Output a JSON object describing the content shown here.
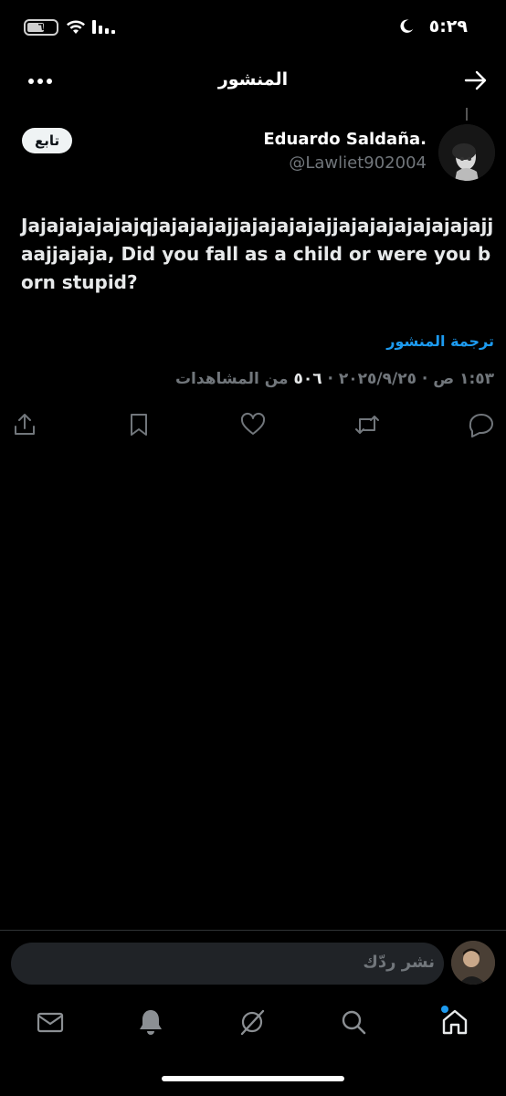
{
  "status_bar": {
    "time": "٥:٢٩",
    "battery_level": "٦"
  },
  "header": {
    "title": "المنشور"
  },
  "author": {
    "name": "Eduardo Saldaña.",
    "handle": "@Lawliet902004",
    "follow_label": "تابع"
  },
  "post": {
    "text": "Jajajajajajajqjajajajajjajajajajajjajajajajajajajajjaajjajaja, Did you fall as a child or were you born stupid?",
    "translate_label": "ترجمة المنشور",
    "timestamp": "١:٥٣ ص · ٢٠٢٥/٩/٢٥ ·",
    "views_count": "٥٠٦",
    "views_label": "من المشاهدات"
  },
  "actions": [
    "reply",
    "repost",
    "like",
    "bookmark",
    "share"
  ],
  "reply_bar": {
    "placeholder": "نشر ردّك"
  },
  "bottom_nav": [
    "home",
    "search",
    "grok",
    "notifications",
    "messages"
  ],
  "colors": {
    "accent": "#1d9bf0",
    "background": "#000000",
    "muted": "#71767b"
  }
}
